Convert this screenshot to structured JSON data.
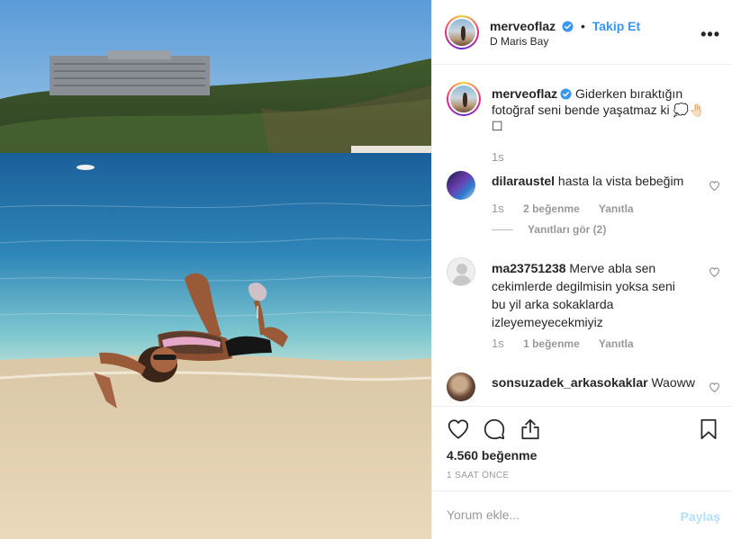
{
  "header": {
    "username": "merveofl az",
    "separator": "•",
    "follow_label": "Takip Et",
    "location": "D Maris Bay",
    "more_label": "•••"
  },
  "caption": {
    "username": "merveofl az",
    "text": "Giderken bıraktığın fotoğraf seni bende yaşatmaz ki 💭🤚🏻",
    "extra_glyph": "☐",
    "time": "1s"
  },
  "comments": [
    {
      "username": "dilaraustel",
      "text": "hasta la vista bebeğim",
      "time": "1s",
      "likes": "2 beğenme",
      "reply": "Yanıtla",
      "view_replies": "Yanıtları gör (2)"
    },
    {
      "username": "ma23751238",
      "text": "Merve abla sen cekimlerde degilmisin yoksa seni bu yil arka sokaklarda izleyemeyecekmiyiz",
      "time": "1s",
      "likes": "1 beğenme",
      "reply": "Yanıtla"
    },
    {
      "username": "sonsuzadek_arkasokaklar",
      "text": "Waoww"
    }
  ],
  "stats": {
    "likes": "4.560 beğenme",
    "posted": "1 SAAT ÖNCE"
  },
  "comment_box": {
    "placeholder": "Yorum ekle...",
    "post_label": "Paylaş"
  },
  "colors": {
    "accent": "#3897f0",
    "muted": "#999999",
    "border": "#efefef",
    "post_disabled": "#b2dffc"
  },
  "icons": {
    "verified": "verified-badge-icon",
    "like": "heart-icon",
    "comment": "comment-bubble-icon",
    "share": "share-icon",
    "save": "bookmark-icon",
    "more": "more-options-icon"
  }
}
